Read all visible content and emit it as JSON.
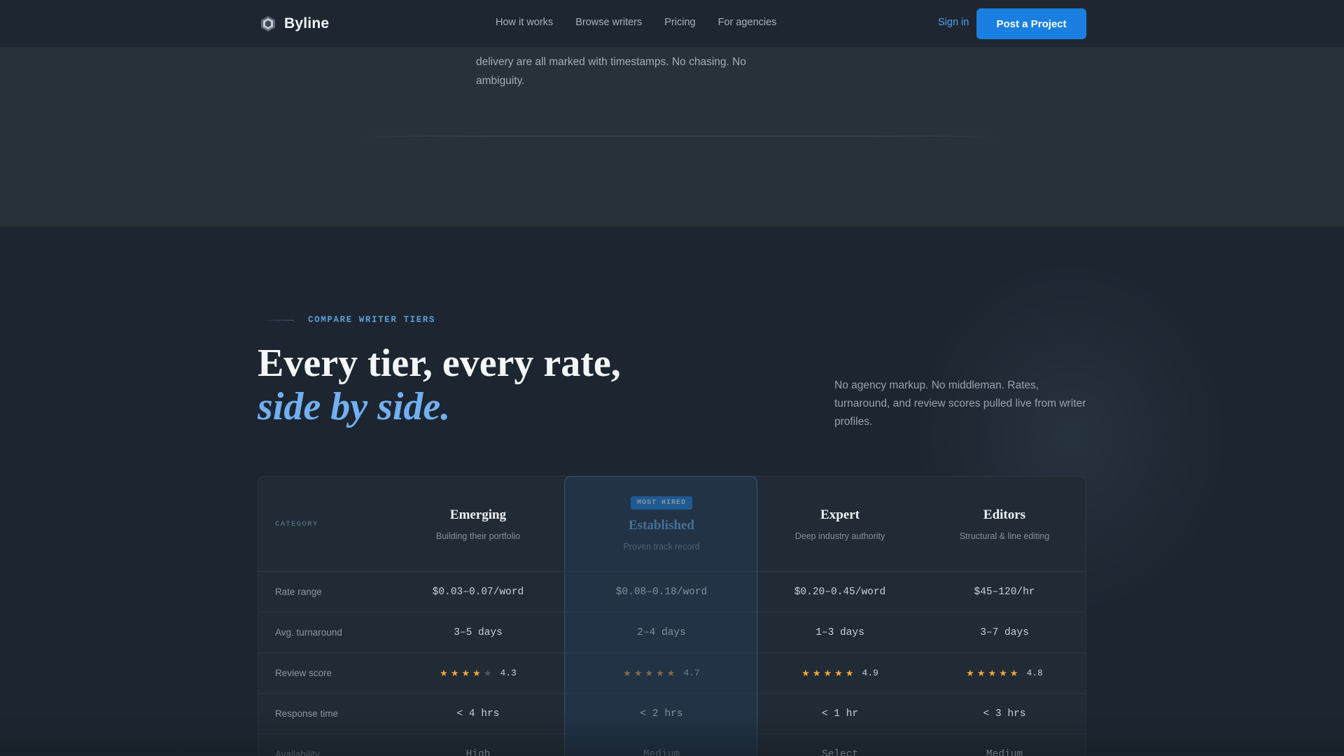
{
  "nav": {
    "brand": "Byline",
    "links": [
      "How it works",
      "Browse writers",
      "Pricing",
      "For agencies"
    ],
    "signin": "Sign in",
    "cta": "Post a Project",
    "logo_icon": "hexagon-badge-icon"
  },
  "top": {
    "paragraph": "delivery are all marked with timestamps. No chasing. No ambiguity."
  },
  "compare": {
    "eyebrow": "COMPARE WRITER TIERS",
    "headline_line1": "Every tier, every rate,",
    "headline_line2": "side by side.",
    "side_note": "No agency markup. No middleman. Rates, turnaround, and review scores pulled live from writer profiles."
  },
  "table": {
    "category_label": "CATEGORY",
    "badge": "MOST HIRED",
    "tiers": [
      {
        "name": "Emerging",
        "subtitle": "Building their portfolio"
      },
      {
        "name": "Established",
        "subtitle": "Proven track record"
      },
      {
        "name": "Expert",
        "subtitle": "Deep industry authority"
      },
      {
        "name": "Editors",
        "subtitle": "Structural & line editing"
      }
    ],
    "rows": [
      {
        "label": "Rate range",
        "values": [
          "$0.03–0.07/word",
          "$0.08–0.18/word",
          "$0.20–0.45/word",
          "$45–120/hr"
        ]
      },
      {
        "label": "Avg. turnaround",
        "values": [
          "3–5 days",
          "2–4 days",
          "1–3 days",
          "3–7 days"
        ]
      },
      {
        "label": "Review score",
        "values": [
          "4.3",
          "4.7",
          "4.9",
          "4.8"
        ],
        "stars_filled": [
          4,
          5,
          5,
          5
        ]
      },
      {
        "label": "Response time",
        "values": [
          "< 4 hrs",
          "< 2 hrs",
          "< 1 hr",
          "< 3 hrs"
        ]
      },
      {
        "label": "Availability",
        "values": [
          "High",
          "Medium",
          "Select",
          "Medium"
        ]
      }
    ]
  },
  "colors": {
    "accent": "#1a7fe0",
    "accent_text": "#6fb0f2",
    "star": "#f2a43c",
    "background": "#1c2530"
  }
}
